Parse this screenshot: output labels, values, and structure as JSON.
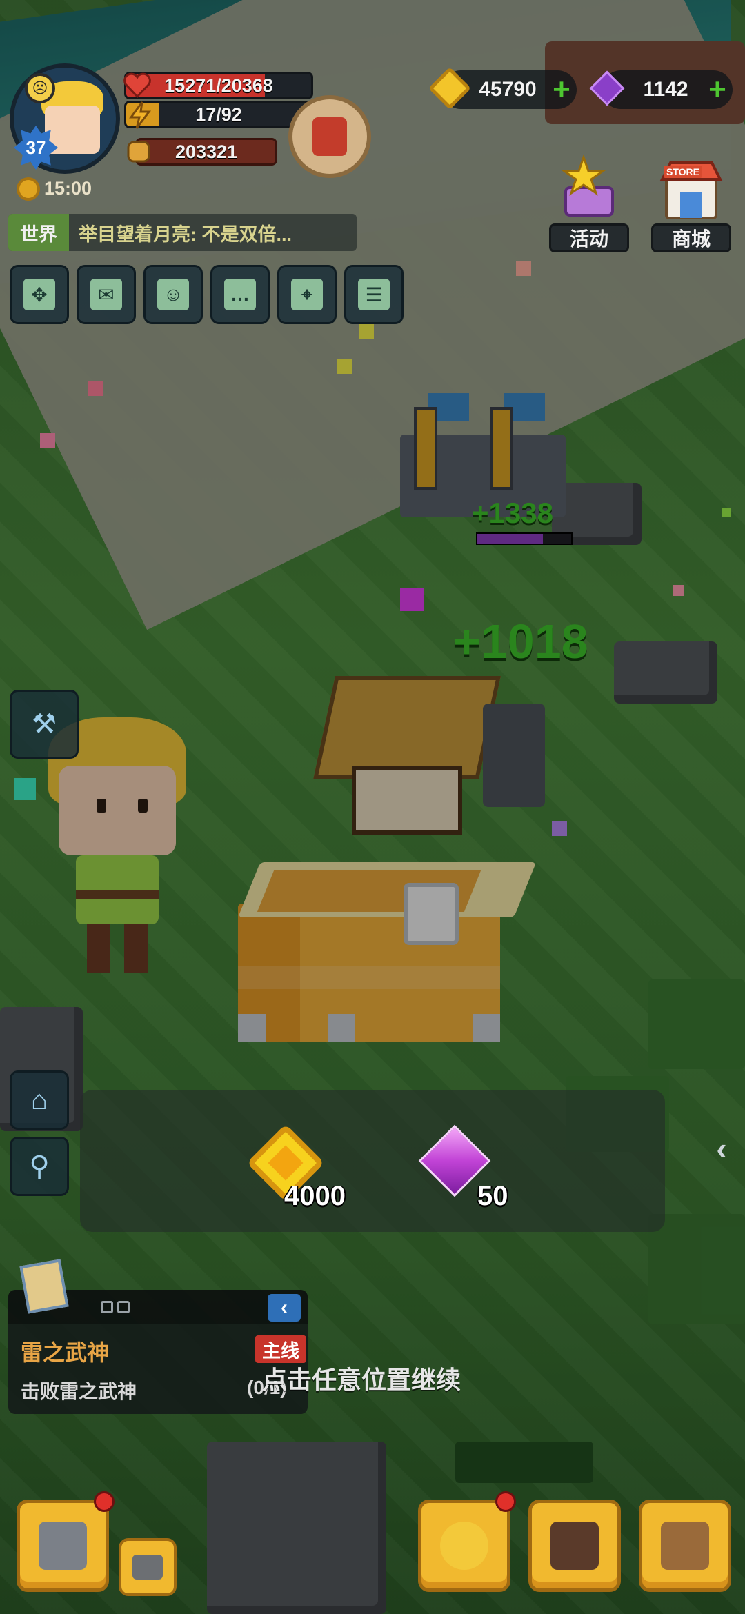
{
  "player": {
    "level": "37",
    "hp": "15271/20368",
    "hp_fraction": 0.75,
    "energy": "17/92",
    "energy_fraction": 0.18,
    "power": "203321",
    "time": "15:00"
  },
  "currency": {
    "coins": "45790",
    "gems": "1142"
  },
  "chat": {
    "channel": "世界",
    "message": "举目望着月亮: 不是双倍..."
  },
  "shop_buttons": {
    "events_label": "活动",
    "store_label": "商城",
    "store_tag": "STORE"
  },
  "quick_buttons": [
    {
      "icon": "expand-arrows-icon"
    },
    {
      "icon": "mail-icon"
    },
    {
      "icon": "friends-icon"
    },
    {
      "icon": "chat-bubble-icon"
    },
    {
      "icon": "map-pin-icon"
    },
    {
      "icon": "clipboard-icon"
    }
  ],
  "reward": {
    "coin_amount": "4000",
    "gem_amount": "50"
  },
  "quest": {
    "title": "雷之武神",
    "tag": "主线",
    "description": "击败雷之武神",
    "progress": "(0/1)"
  },
  "hint": "点击任意位置继续",
  "floating_numbers": [
    "+1338",
    "+1018"
  ],
  "colors": {
    "hp": "#c8332c",
    "energy": "#d89a1e",
    "power": "#b84630",
    "add": "#4ec531",
    "quest_title": "#e8a546"
  }
}
